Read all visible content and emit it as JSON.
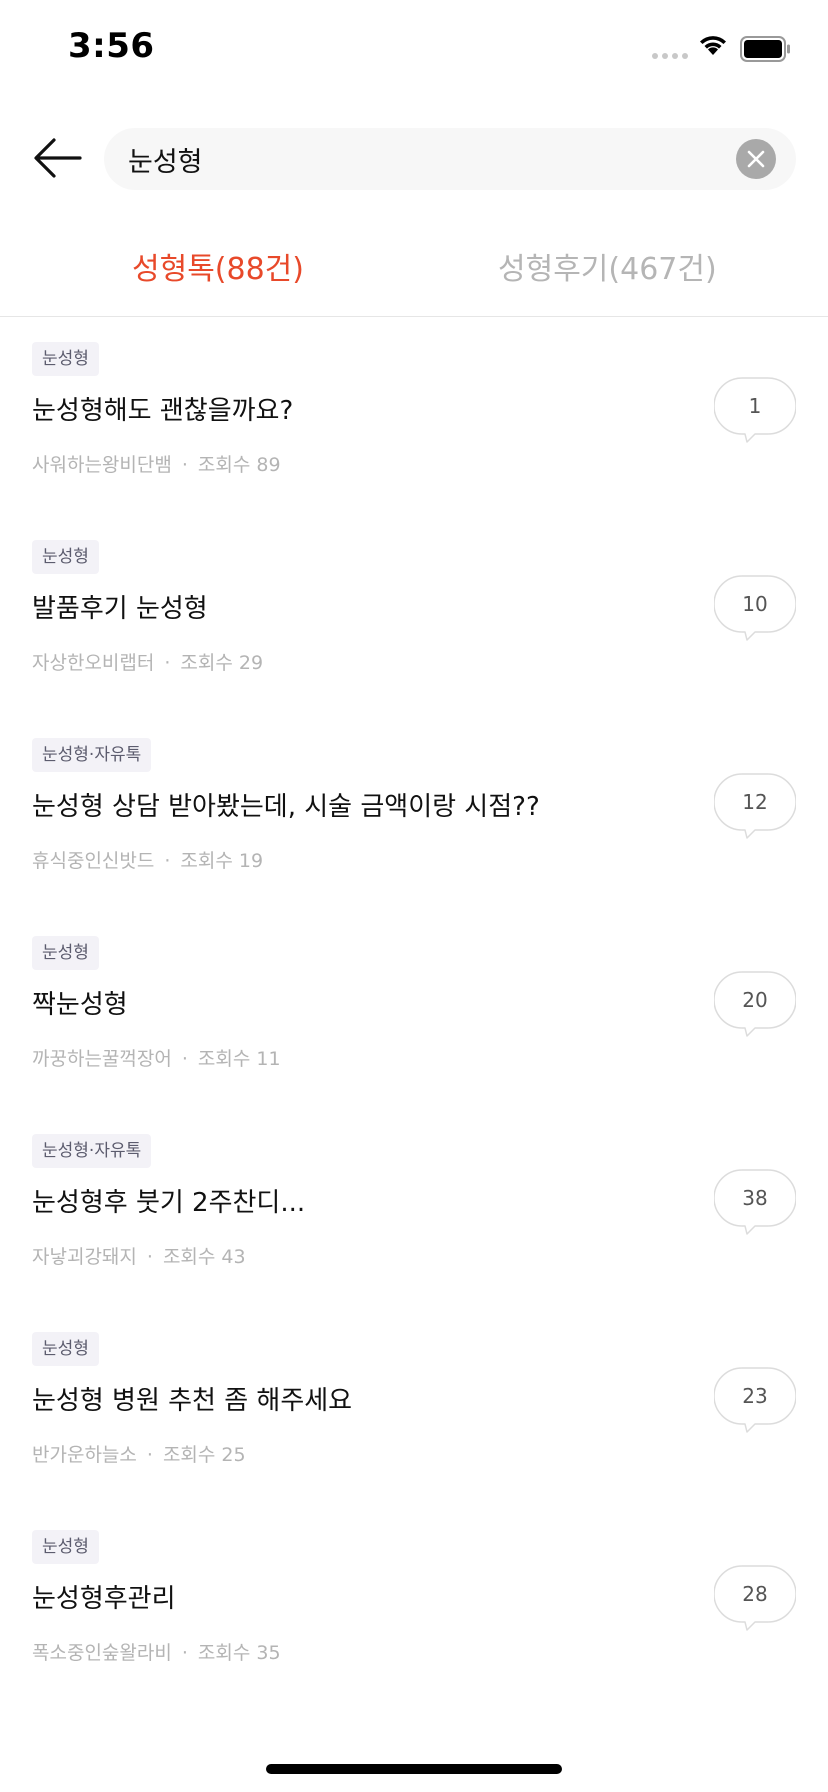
{
  "status_bar": {
    "time": "3:56"
  },
  "search": {
    "value": "눈성형"
  },
  "tabs": [
    {
      "label": "성형톡(88건)",
      "active": true
    },
    {
      "label": "성형후기(467건)",
      "active": false
    }
  ],
  "posts": [
    {
      "tag": "눈성형",
      "title": "눈성형해도 괜찮을까요?",
      "author": "사워하는왕비단뱀",
      "views": "조회수 89",
      "comments": "1"
    },
    {
      "tag": "눈성형",
      "title": "발품후기 눈성형",
      "author": "자상한오비랩터",
      "views": "조회수 29",
      "comments": "10"
    },
    {
      "tag": "눈성형·자유톡",
      "title": "눈성형 상담 받아봤는데, 시술 금액이랑 시점??",
      "author": "휴식중인신밧드",
      "views": "조회수 19",
      "comments": "12"
    },
    {
      "tag": "눈성형",
      "title": "짝눈성형",
      "author": "까꿍하는꿀꺽장어",
      "views": "조회수 11",
      "comments": "20"
    },
    {
      "tag": "눈성형·자유톡",
      "title": "눈성형후 붓기 2주찬디...",
      "author": "자낳괴강돼지",
      "views": "조회수 43",
      "comments": "38"
    },
    {
      "tag": "눈성형",
      "title": "눈성형 병원 추천 좀 해주세요",
      "author": "반가운하늘소",
      "views": "조회수 25",
      "comments": "23"
    },
    {
      "tag": "눈성형",
      "title": "눈성형후관리",
      "author": "폭소중인숲왈라비",
      "views": "조회수 35",
      "comments": "28"
    }
  ],
  "colors": {
    "accent": "#e8492a",
    "inactive_tab": "#b5b5b5",
    "meta": "#b4b4b4",
    "tag_bg": "#f3f2f7"
  },
  "icons": {
    "back": "arrow-left-icon",
    "clear": "close-circle-icon",
    "comment": "speech-bubble-icon"
  }
}
